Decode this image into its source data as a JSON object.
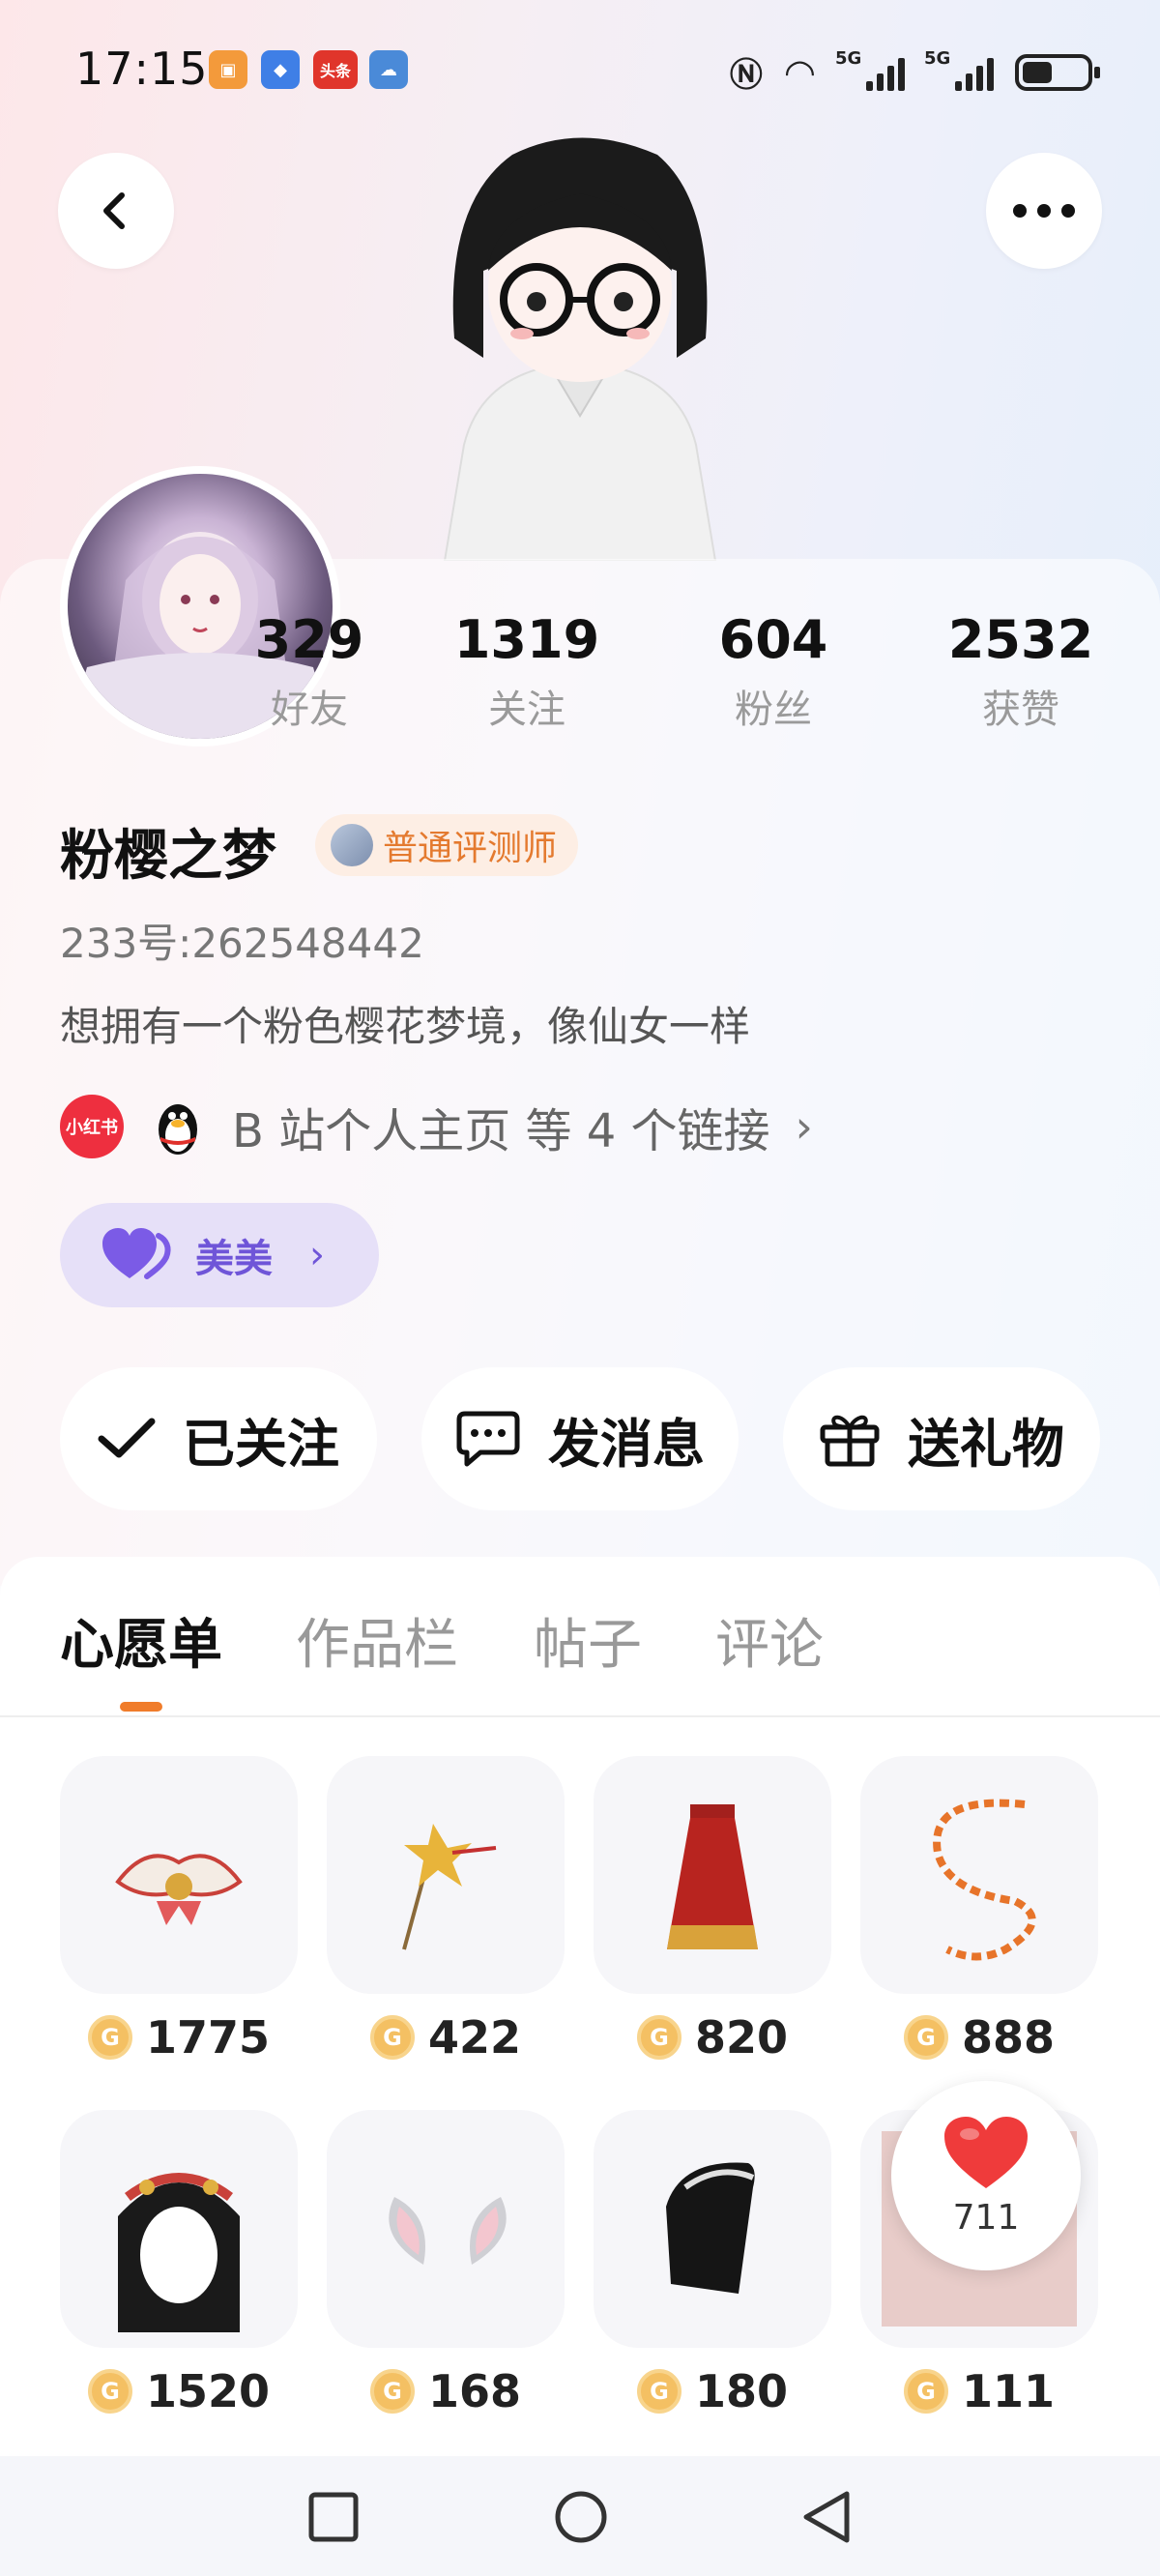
{
  "status": {
    "time": "17:15",
    "app_icons": [
      "app-icon-orange",
      "app-icon-blue",
      "头条",
      "weather-icon"
    ],
    "signal_labels": [
      "5G",
      "5G"
    ]
  },
  "profile": {
    "stats": [
      {
        "value": "329",
        "label": "好友"
      },
      {
        "value": "1319",
        "label": "关注"
      },
      {
        "value": "604",
        "label": "粉丝"
      },
      {
        "value": "2532",
        "label": "获赞"
      }
    ],
    "name": "粉樱之梦",
    "badge": "普通评测师",
    "uid": "233号:262548442",
    "bio": "想拥有一个粉色樱花梦境，像仙女一样",
    "xhs_label": "小红书",
    "links_text": "B 站个人主页 等 4 个链接",
    "tag": "美美"
  },
  "actions": {
    "follow": "已关注",
    "message": "发消息",
    "gift": "送礼物"
  },
  "tabs": [
    "心愿单",
    "作品栏",
    "帖子",
    "评论"
  ],
  "wishlist": [
    {
      "price": "1775"
    },
    {
      "price": "422"
    },
    {
      "price": "820"
    },
    {
      "price": "888"
    },
    {
      "price": "1520"
    },
    {
      "price": "168"
    },
    {
      "price": "180"
    },
    {
      "price": "111"
    }
  ],
  "like_count": "711",
  "colors": {
    "accent": "#f07c2a",
    "tag_purple": "#6f55d8",
    "badge_orange": "#e47a2f"
  }
}
